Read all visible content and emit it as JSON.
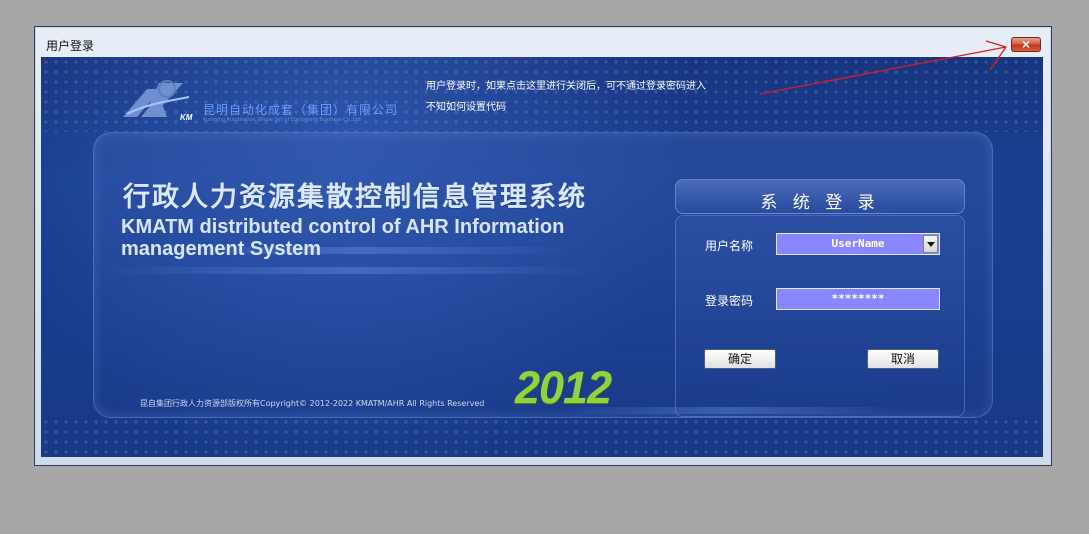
{
  "window": {
    "title": "用户登录",
    "close_glyph": "×"
  },
  "logo": {
    "mark_text": "KM",
    "company_cn": "昆明自动化成套（集团）有限公司",
    "company_en": "Kunming Automation Whole Set of Equipment Business Co.,Ltd"
  },
  "notes": {
    "line1": "用户登录时，如果点击这里进行关闭后，可不通过登录密码进入",
    "line2": "不知如何设置代码"
  },
  "banner": {
    "title_cn": "行政人力资源集散控制信息管理系统",
    "title_en": "KMATM distributed control of AHR Information management System",
    "year": "2012",
    "copyright": "昆自集团行政人力资源部版权所有Copyright© 2012-2022 KMATM/AHR All Rights Reserved"
  },
  "login": {
    "title": "系 统 登 录",
    "username_label": "用户名称",
    "username_value": "UserName",
    "password_label": "登录密码",
    "password_value": "********",
    "ok_label": "确定",
    "cancel_label": "取消"
  },
  "colors": {
    "desktop_bg": "#a7a7a7",
    "panel_blue": "#1a3f92",
    "field_purple": "#8a86ff",
    "year_green": "#92d23d",
    "arrow_red": "#d71f1f"
  },
  "icons": {
    "close": "close-icon",
    "dropdown": "chevron-down-icon",
    "annotation": "red-pointer-arrow"
  }
}
